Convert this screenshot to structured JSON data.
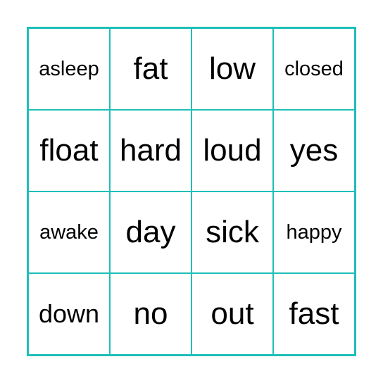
{
  "card": {
    "border_color": "#1ebfb8",
    "cells": [
      {
        "text": "asleep",
        "size": "small"
      },
      {
        "text": "fat",
        "size": "big"
      },
      {
        "text": "low",
        "size": "big"
      },
      {
        "text": "closed",
        "size": "small"
      },
      {
        "text": "float",
        "size": "big"
      },
      {
        "text": "hard",
        "size": "big"
      },
      {
        "text": "loud",
        "size": "big"
      },
      {
        "text": "yes",
        "size": "big"
      },
      {
        "text": "awake",
        "size": "small"
      },
      {
        "text": "day",
        "size": "big"
      },
      {
        "text": "sick",
        "size": "big"
      },
      {
        "text": "happy",
        "size": "small"
      },
      {
        "text": "down",
        "size": "small"
      },
      {
        "text": "no",
        "size": "big"
      },
      {
        "text": "out",
        "size": "big"
      },
      {
        "text": "fast",
        "size": "big"
      }
    ]
  }
}
